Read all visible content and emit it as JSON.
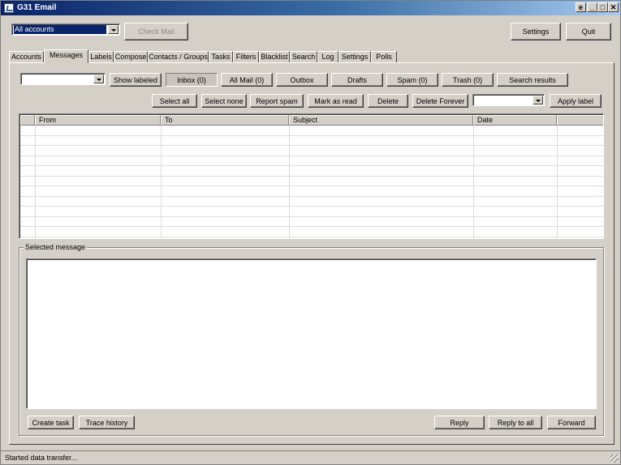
{
  "window": {
    "title": "G31 Email"
  },
  "titlebar_buttons": [
    {
      "label": "e"
    },
    {
      "label": "_"
    },
    {
      "label": "□"
    },
    {
      "label": "✕"
    }
  ],
  "top": {
    "account_select_value": "All accounts",
    "check_mail_label": "Check Mail",
    "settings_label": "Settings",
    "quit_label": "Quit"
  },
  "tabs": [
    {
      "label": "Accounts"
    },
    {
      "label": "Messages"
    },
    {
      "label": "Labels"
    },
    {
      "label": "Compose"
    },
    {
      "label": "Contacts / Groups"
    },
    {
      "label": "Tasks"
    },
    {
      "label": "Filters"
    },
    {
      "label": "Blacklist"
    },
    {
      "label": "Search"
    },
    {
      "label": "Log"
    },
    {
      "label": "Settings"
    },
    {
      "label": "Polls"
    }
  ],
  "folder_bar": {
    "label_select_value": "",
    "show_labeled": "Show labeled",
    "inbox": "Inbox (0)",
    "all_mail": "All Mail (0)",
    "outbox": "Outbox",
    "drafts": "Drafts",
    "spam": "Spam (0)",
    "trash": "Trash (0)",
    "search_results": "Search results"
  },
  "action_bar": {
    "select_all": "Select all",
    "select_none": "Select none",
    "report_spam": "Report spam",
    "mark_as_read": "Mark as read",
    "delete": "Delete",
    "delete_forever": "Delete Forever",
    "apply_label_select_value": "",
    "apply_label": "Apply label"
  },
  "table": {
    "columns": [
      "",
      "From",
      "To",
      "Subject",
      "Date",
      ""
    ]
  },
  "selected_message": {
    "legend": "Selected message",
    "body": ""
  },
  "bottom_buttons": {
    "create_task": "Create task",
    "trace_history": "Trace history",
    "reply": "Reply",
    "reply_to_all": "Reply to all",
    "forward": "Forward"
  },
  "status": {
    "text": "Started data transfer..."
  }
}
